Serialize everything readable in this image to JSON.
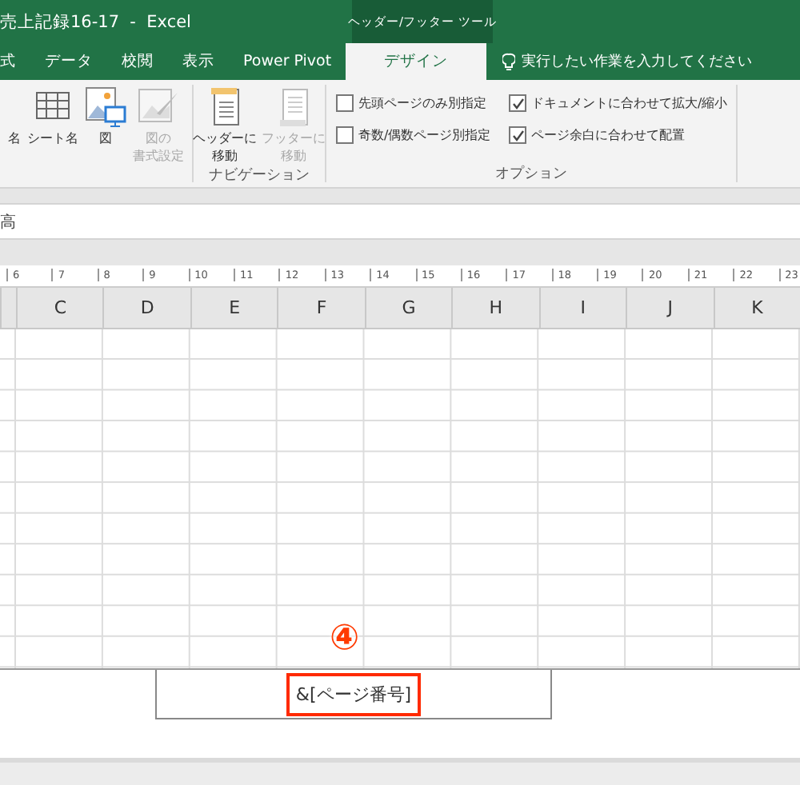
{
  "title_bar": {
    "title": "売上記録16-17  -  Excel",
    "context_label": "ヘッダー/フッター ツール"
  },
  "tabs": [
    {
      "label": "式",
      "selected": false
    },
    {
      "label": "データ",
      "selected": false
    },
    {
      "label": "校閲",
      "selected": false
    },
    {
      "label": "表示",
      "selected": false
    },
    {
      "label": "Power Pivot",
      "selected": false
    },
    {
      "label": "デザイン",
      "selected": true
    }
  ],
  "tell_me": {
    "placeholder": "実行したい作業を入力してください"
  },
  "elements_group": {
    "buttons": [
      {
        "kind": "none",
        "lines": [
          "名"
        ],
        "disabled": false
      },
      {
        "kind": "sheet",
        "lines": [
          "シート名"
        ],
        "disabled": false
      },
      {
        "kind": "picture",
        "lines": [
          "図"
        ],
        "disabled": false
      },
      {
        "kind": "format",
        "lines": [
          "図の",
          "書式設定"
        ],
        "disabled": true
      }
    ]
  },
  "navigation_group": {
    "label": "ナビゲーション",
    "buttons": [
      {
        "kind": "header",
        "lines": [
          "ヘッダーに",
          "移動"
        ],
        "disabled": false
      },
      {
        "kind": "footer",
        "lines": [
          "フッターに",
          "移動"
        ],
        "disabled": true
      }
    ]
  },
  "options_group": {
    "label": "オプション",
    "checkboxes": [
      {
        "label": "先頭ページのみ別指定",
        "checked": false
      },
      {
        "label": "奇数/偶数ページ別指定",
        "checked": false
      },
      {
        "label": "ドキュメントに合わせて拡大/縮小",
        "checked": true
      },
      {
        "label": "ページ余白に合わせて配置",
        "checked": true
      }
    ]
  },
  "formula_bar": {
    "value": "高"
  },
  "ruler": [
    "6",
    "7",
    "8",
    "9",
    "10",
    "11",
    "12",
    "13",
    "14",
    "15",
    "16",
    "17",
    "18",
    "19",
    "20",
    "21",
    "22",
    "23"
  ],
  "columns": [
    "C",
    "D",
    "E",
    "F",
    "G",
    "H",
    "I",
    "J",
    "K"
  ],
  "footer": {
    "marker": "④",
    "center": "&[ページ番号]"
  }
}
